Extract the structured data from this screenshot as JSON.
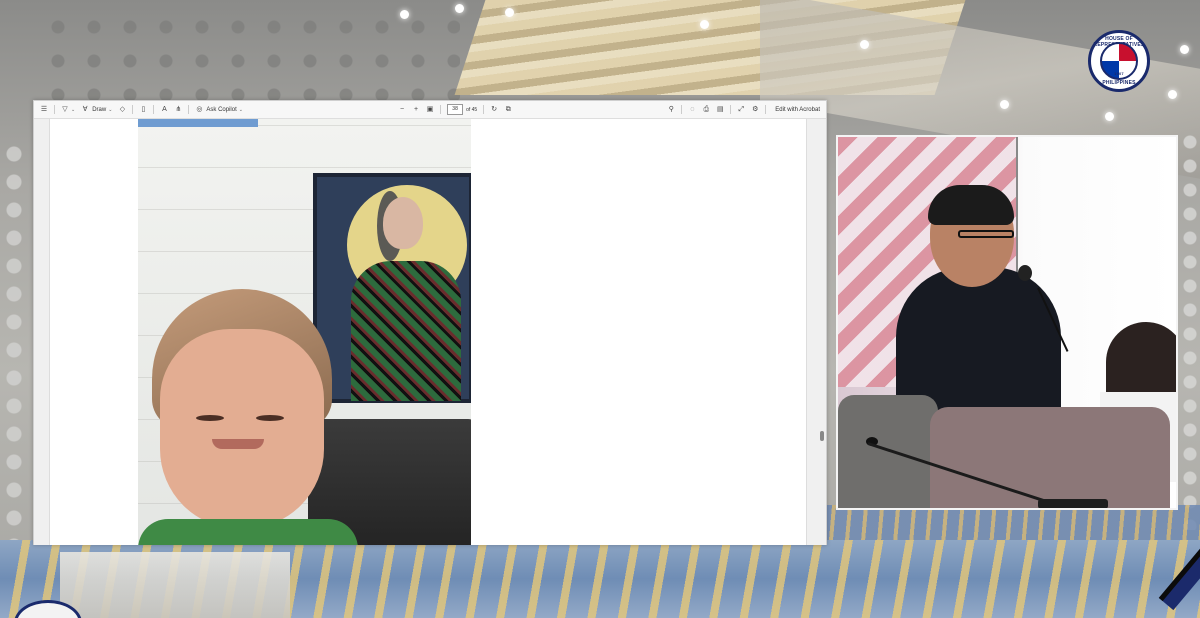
{
  "toolbar": {
    "draw_label": "Draw",
    "ask_copilot_label": "Ask Copilot",
    "page_number": "38",
    "page_total": "of 45",
    "edit_acrobat_label": "Edit with Acrobat"
  },
  "seal": {
    "top_text": "HOUSE OF REPRESENTATIVES",
    "year": "1907",
    "bottom_text": "PHILIPPINES"
  },
  "icons": {
    "menu": "menu-icon",
    "filter": "filter-icon",
    "draw": "draw-icon",
    "eraser": "eraser-icon",
    "text_select": "text-select-icon",
    "read_aloud": "read-aloud-icon",
    "immersive": "immersive-reader-icon",
    "copilot": "copilot-icon",
    "zoom_out": "zoom-out-icon",
    "zoom_in": "zoom-in-icon",
    "fit_page": "fit-page-icon",
    "rotate": "rotate-icon",
    "two_page": "two-page-view-icon",
    "search": "search-icon",
    "print": "print-icon",
    "save": "save-icon",
    "fullscreen": "fullscreen-icon",
    "settings": "settings-icon"
  },
  "colors": {
    "accent_navy": "#1b2a6b",
    "toolbar_bg": "#f7f7f7",
    "page_bg": "#ffffff"
  }
}
